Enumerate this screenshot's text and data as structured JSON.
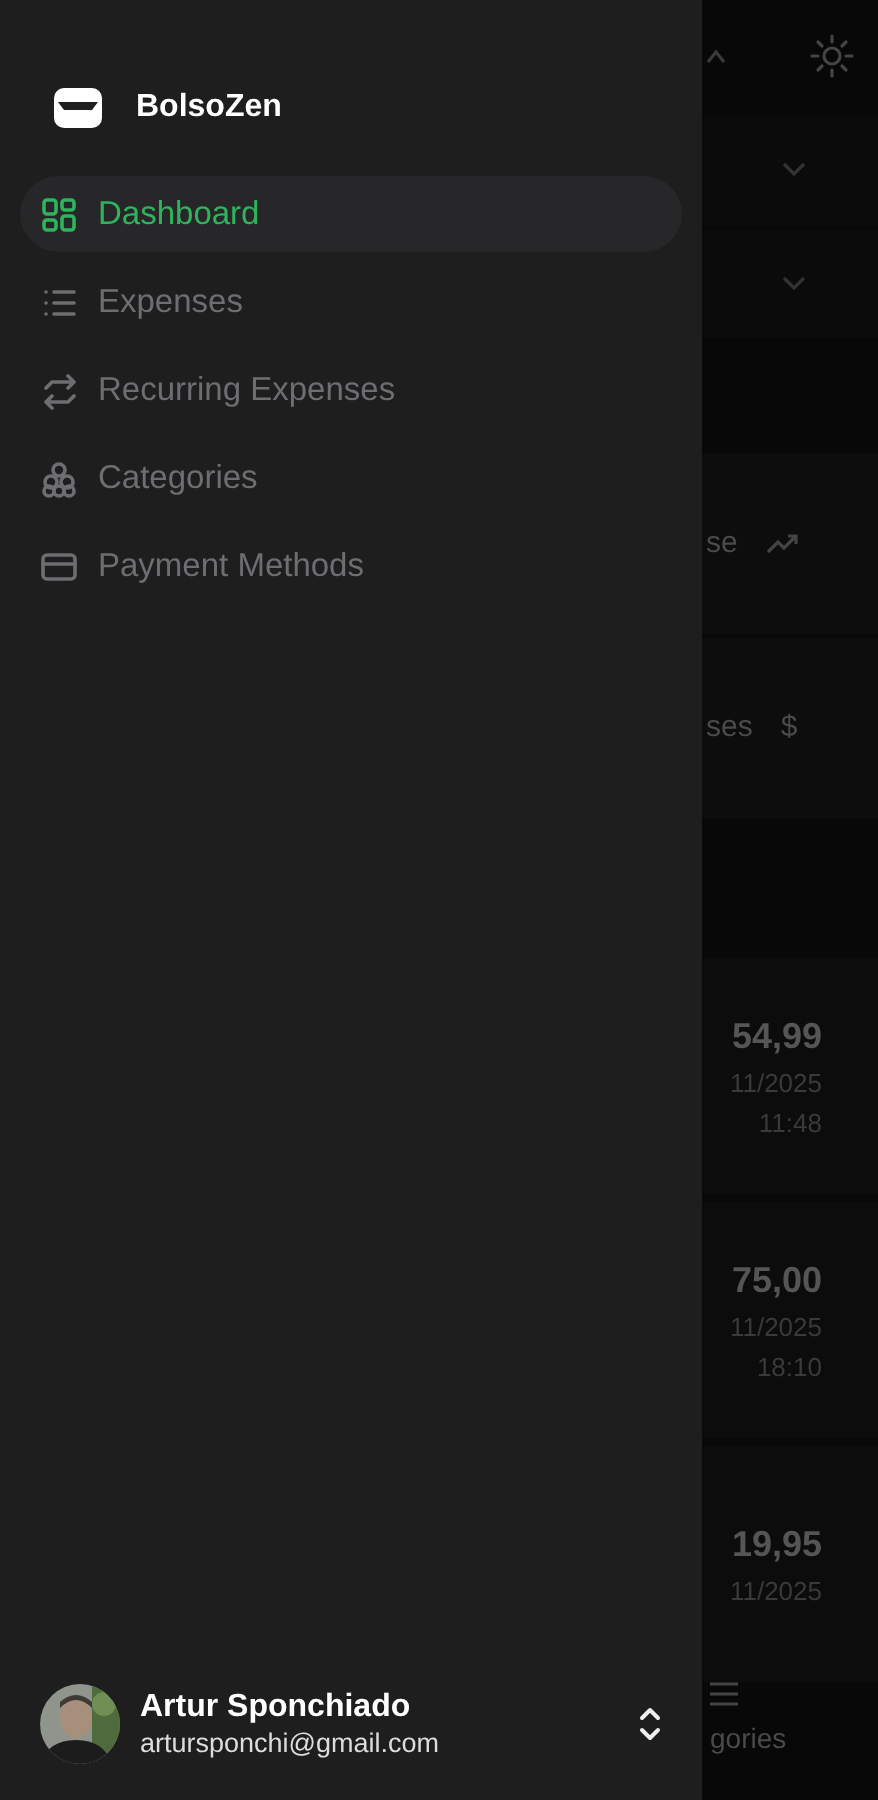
{
  "app": {
    "name": "BolsoZen"
  },
  "nav": [
    {
      "label": "Dashboard",
      "kind": "grid",
      "selected": true
    },
    {
      "label": "Expenses",
      "kind": "list",
      "selected": false
    },
    {
      "label": "Recurring Expenses",
      "kind": "repeat",
      "selected": false
    },
    {
      "label": "Categories",
      "kind": "shapes",
      "selected": false
    },
    {
      "label": "Payment Methods",
      "kind": "card",
      "selected": false
    }
  ],
  "user": {
    "name": "Artur Sponchiado",
    "email": "artursponchi@gmail.com"
  },
  "background": {
    "cards": [
      {
        "label": "se",
        "kind": "trend"
      },
      {
        "label": "ses",
        "symbol": "$"
      }
    ],
    "expenses": [
      {
        "amount": "54,99",
        "date": "11/2025",
        "time": "11:48"
      },
      {
        "amount": "75,00",
        "date": "11/2025",
        "time": "18:10"
      },
      {
        "amount": "19,95",
        "date": "11/2025"
      }
    ],
    "bottom_nav_label": "gories"
  }
}
